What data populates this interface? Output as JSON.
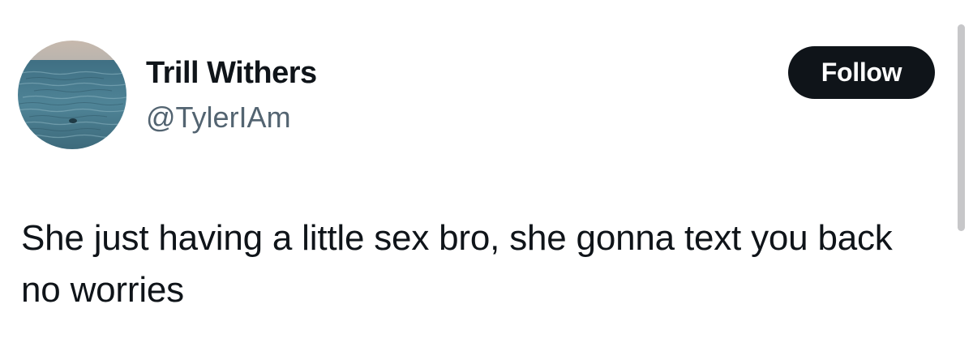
{
  "author": {
    "display_name": "Trill Withers",
    "handle": "@TylerIAm",
    "avatar_description": "ocean-avatar"
  },
  "actions": {
    "follow_label": "Follow"
  },
  "tweet": {
    "text": "She just having a little sex bro, she gonna text you back no worries"
  },
  "colors": {
    "text_primary": "#0f1419",
    "text_secondary": "#536471",
    "button_bg": "#0f1419",
    "button_text": "#ffffff",
    "background": "#ffffff",
    "scrollbar": "#c7c7c9"
  }
}
